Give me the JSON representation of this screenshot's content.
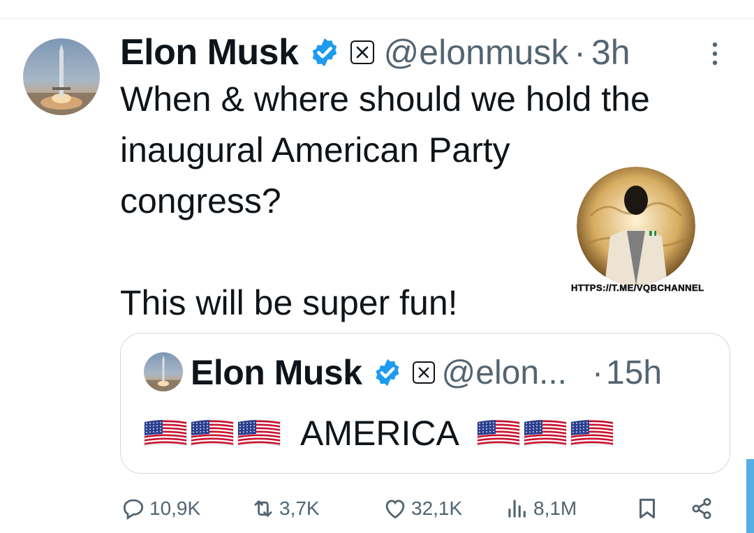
{
  "tweet": {
    "author_name": "Elon Musk",
    "handle": "@elonmusk",
    "separator": "·",
    "time": "3h",
    "text": "When & where should we hold the\ninaugural American Party\ncongress?\n\nThis will be super fun!"
  },
  "watermark": {
    "url": "HTTPS://T.ME/VQBCHANNEL"
  },
  "quoted_tweet": {
    "author_name": "Elon Musk",
    "handle": "@elon...",
    "separator": "·",
    "time": "15h",
    "text": "AMERICA",
    "flags_before": 3,
    "flags_after": 3
  },
  "actions": {
    "replies": "10,9K",
    "reposts": "3,7K",
    "likes": "32,1K",
    "views": "8,1M"
  },
  "icons": [
    "verified-badge-icon",
    "x-logo-icon",
    "more-icon",
    "reply-icon",
    "repost-icon",
    "like-icon",
    "views-icon",
    "bookmark-icon",
    "share-icon",
    "us-flag-icon"
  ],
  "colors": {
    "accent": "#1d9bf0",
    "muted": "#536471",
    "text": "#0f1419",
    "border": "#cfd9de"
  }
}
